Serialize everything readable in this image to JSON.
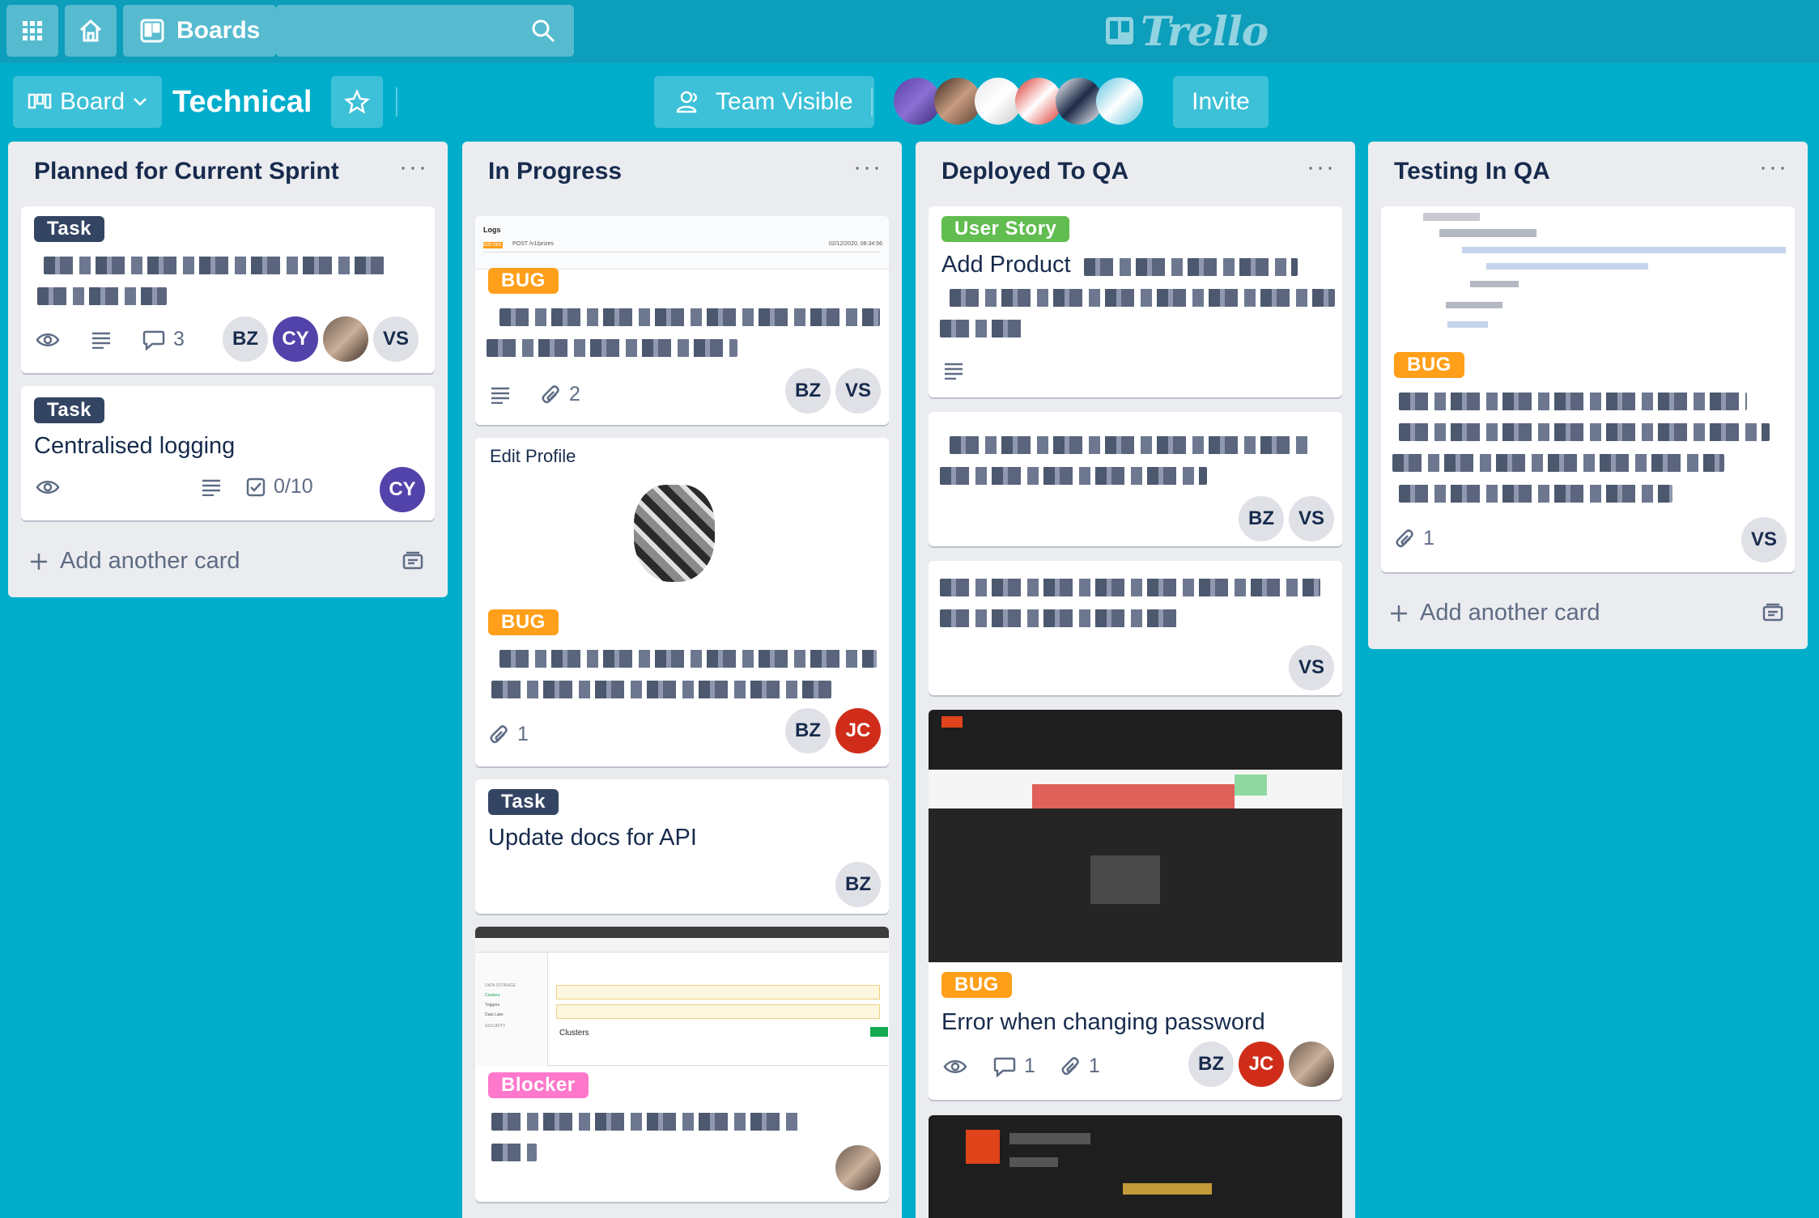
{
  "header": {
    "boards_label": "Boards",
    "logo_text": "Trello"
  },
  "board": {
    "view_label": "Board",
    "title": "Technical",
    "visibility_label": "Team Visible",
    "invite_label": "Invite"
  },
  "lists": [
    {
      "title": "Planned for Current Sprint",
      "add_card_label": "Add another card",
      "cards": [
        {
          "label": "Task",
          "badges": {
            "comments": "3"
          },
          "members": [
            "BZ",
            "CY",
            "VS"
          ]
        },
        {
          "label": "Task",
          "title": "Centralised logging",
          "badges": {
            "checklist": "0/10"
          },
          "members": [
            "CY"
          ]
        }
      ]
    },
    {
      "title": "In Progress",
      "cards": [
        {
          "cover": {
            "title": "Logs",
            "tag": "ADD DBS",
            "path": "POST /v1/prizes",
            "timestamp": "02/12/2020, 08:34:56"
          },
          "label": "BUG",
          "badges": {
            "attachments": "2"
          },
          "members": [
            "BZ",
            "VS"
          ]
        },
        {
          "cover_title": "Edit Profile",
          "label": "BUG",
          "badges": {
            "attachments": "1"
          },
          "members": [
            "BZ",
            "JC"
          ]
        },
        {
          "label": "Task",
          "title": "Update docs for API",
          "members": [
            "BZ"
          ]
        },
        {
          "cover": {
            "section": "DATA STORAGE",
            "nav": [
              "Clusters",
              "Triggers",
              "Data Lake"
            ],
            "security": "SECURITY",
            "heading": "Clusters"
          },
          "label": "Blocker"
        }
      ]
    },
    {
      "title": "Deployed To QA",
      "cards": [
        {
          "label": "User Story",
          "title": "Add Product"
        },
        {
          "members": [
            "BZ",
            "VS"
          ]
        },
        {
          "members": [
            "VS"
          ]
        },
        {
          "label": "BUG",
          "title": "Error when changing password",
          "badges": {
            "comments": "1",
            "attachments": "1"
          },
          "members": [
            "BZ",
            "JC"
          ]
        }
      ]
    },
    {
      "title": "Testing In QA",
      "add_card_label": "Add another card",
      "cards": [
        {
          "label": "BUG",
          "badges": {
            "attachments": "1"
          },
          "members": [
            "VS"
          ]
        }
      ]
    }
  ],
  "colors": {
    "background": "#00aecc",
    "header": "#0d9ebb",
    "label_task": "#344563",
    "label_bug": "#ff9f1a",
    "label_story": "#61bd4f",
    "label_blocker": "#ff78cb",
    "avatar_cy": "#5243aa",
    "avatar_jc": "#cf2d1a"
  }
}
